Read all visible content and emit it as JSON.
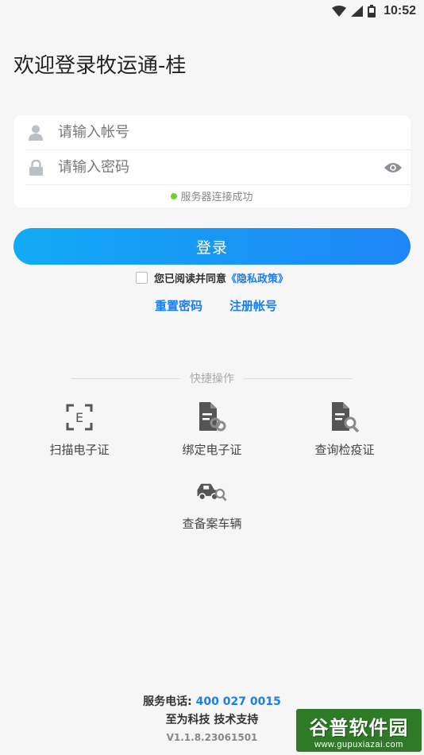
{
  "status_bar": {
    "time": "10:52"
  },
  "title": "欢迎登录牧运通-桂",
  "form": {
    "account_placeholder": "请输入帐号",
    "password_placeholder": "请输入密码",
    "server_status": "服务器连接成功",
    "server_status_color": "#6ed32a"
  },
  "login_button": "登录",
  "agreement": {
    "text": "您已阅读并同意",
    "privacy_link": "《隐私政策》",
    "checked": false
  },
  "links": {
    "reset_password": "重置密码",
    "register": "注册帐号"
  },
  "quick_actions": {
    "title": "快捷操作",
    "items": [
      {
        "label": "扫描电子证",
        "icon": "scan-frame-icon"
      },
      {
        "label": "绑定电子证",
        "icon": "document-link-icon"
      },
      {
        "label": "查询检疫证",
        "icon": "document-search-icon"
      },
      {
        "label": "查备案车辆",
        "icon": "truck-search-icon"
      }
    ]
  },
  "footer": {
    "phone_label": "服务电话:",
    "phone_number": "400 027 0015",
    "support": "至为科技 技术支持",
    "version": "V1.1.8.23061501"
  },
  "watermark": {
    "title": "谷普软件园",
    "url": "www.gupuxiazai.com"
  },
  "colors": {
    "accent": "#1a7ef0",
    "button_gradient_start": "#12aaf6",
    "button_gradient_end": "#1e86f7",
    "icon_gray": "#555555"
  }
}
